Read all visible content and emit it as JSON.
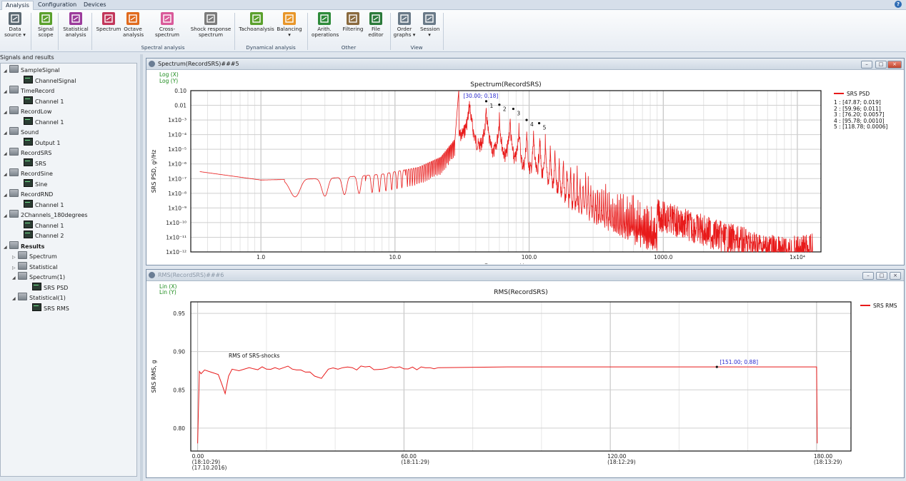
{
  "tabs": [
    "Analysis",
    "Configuration",
    "Devices"
  ],
  "ribbon": {
    "buttons": [
      {
        "label": "Data\nsource ▾",
        "icon": "data-source-icon",
        "color": "#5d6a73"
      },
      {
        "label": "Signal\nscope",
        "icon": "signal-scope-icon",
        "color": "#5aa02c"
      },
      {
        "label": "Statistical\nanalysis",
        "icon": "statistical-icon",
        "color": "#9b3b9b"
      },
      {
        "label": "Spectrum",
        "icon": "spectrum-icon",
        "color": "#c2365a"
      },
      {
        "label": "Octave\nanalysis",
        "icon": "octave-icon",
        "color": "#e06a1d"
      },
      {
        "label": "Cross-spectrum",
        "icon": "cross-spectrum-icon",
        "color": "#d95a9a"
      },
      {
        "label": "Shock response\nspectrum",
        "icon": "shock-icon",
        "color": "#7b7b7b"
      },
      {
        "label": "Tachoanalysis",
        "icon": "tacho-icon",
        "color": "#5aa02c"
      },
      {
        "label": "Balancing\n▾",
        "icon": "balancing-icon",
        "color": "#e8962a"
      },
      {
        "label": "Arith.\noperations",
        "icon": "arith-icon",
        "color": "#2e8b3a"
      },
      {
        "label": "Filtering",
        "icon": "filter-icon",
        "color": "#8a6a3e"
      },
      {
        "label": "File\neditor",
        "icon": "file-editor-icon",
        "color": "#2b7a3a"
      },
      {
        "label": "Order\ngraphs ▾",
        "icon": "order-graphs-icon",
        "color": "#6a7a88"
      },
      {
        "label": "Session\n▾",
        "icon": "session-icon",
        "color": "#6a7a88"
      }
    ],
    "groups": [
      "Spectral analysis",
      "Dynamical analysis",
      "Other",
      "View"
    ]
  },
  "left": {
    "header": "Signals and results",
    "tree": [
      {
        "label": "SampleSignal",
        "type": "folder",
        "depth": 0
      },
      {
        "label": "ChannelSignal",
        "type": "channel",
        "depth": 1
      },
      {
        "label": "TimeRecord",
        "type": "folder",
        "depth": 0
      },
      {
        "label": "Channel 1",
        "type": "channel",
        "depth": 1
      },
      {
        "label": "RecordLow",
        "type": "folder",
        "depth": 0
      },
      {
        "label": "Channel 1",
        "type": "channel",
        "depth": 1
      },
      {
        "label": "Sound",
        "type": "folder",
        "depth": 0
      },
      {
        "label": "Output 1",
        "type": "channel",
        "depth": 1
      },
      {
        "label": "RecordSRS",
        "type": "folder",
        "depth": 0
      },
      {
        "label": "SRS",
        "type": "channel",
        "depth": 1
      },
      {
        "label": "RecordSine",
        "type": "folder",
        "depth": 0
      },
      {
        "label": "Sine",
        "type": "channel",
        "depth": 1
      },
      {
        "label": "RecordRND",
        "type": "folder",
        "depth": 0
      },
      {
        "label": "Channel 1",
        "type": "channel",
        "depth": 1
      },
      {
        "label": "2Channels_180degrees",
        "type": "folder",
        "depth": 0
      },
      {
        "label": "Channel 1",
        "type": "channel",
        "depth": 1
      },
      {
        "label": "Channel 2",
        "type": "channel",
        "depth": 1
      },
      {
        "label": "Results",
        "type": "folder",
        "depth": 0,
        "bold": true
      },
      {
        "label": "Spectrum",
        "type": "folder",
        "depth": 1,
        "collapsed": true
      },
      {
        "label": "Statistical",
        "type": "folder",
        "depth": 1,
        "collapsed": true
      },
      {
        "label": "Spectrum(1)",
        "type": "folder",
        "depth": 1
      },
      {
        "label": "SRS PSD",
        "type": "channel",
        "depth": 2
      },
      {
        "label": "Statistical(1)",
        "type": "folder",
        "depth": 1
      },
      {
        "label": "SRS RMS",
        "type": "channel",
        "depth": 2
      }
    ]
  },
  "panel1": {
    "title": "Spectrum(RecordSRS)###5",
    "scale_x": "Log (X)",
    "scale_y": "Log (Y)",
    "legend": "SRS PSD",
    "peaks": [
      "1 : [47.87; 0.019]",
      "2 : [59.96; 0.011]",
      "3 : [76.20; 0.0057]",
      "4 : [95.78; 0.0010]",
      "5 : [118.78; 0.0006]"
    ]
  },
  "panel2": {
    "title": "RMS(RecordSRS)###6",
    "scale_x": "Lin (X)",
    "scale_y": "Lin (Y)",
    "legend": "SRS RMS"
  },
  "chart_data": [
    {
      "type": "line",
      "title": "Spectrum(RecordSRS)",
      "xlabel": "Frequency, Hz",
      "ylabel": "SRS PSD, g²/Hz",
      "xscale": "log",
      "yscale": "log",
      "xlim": [
        0.3,
        15000
      ],
      "ylim": [
        1e-12,
        0.1
      ],
      "xticks": [
        "1.0",
        "10.0",
        "100.0",
        "1000.0",
        "1x10⁴"
      ],
      "yticks": [
        "0.10",
        "0.01",
        "1x10⁻³",
        "1x10⁻⁴",
        "1x10⁻⁵",
        "1x10⁻⁶",
        "1x10⁻⁷",
        "1x10⁻⁸",
        "1x10⁻⁹",
        "1x10⁻¹⁰",
        "1x10⁻¹¹",
        "1x10⁻¹²"
      ],
      "cursor_label": "[30.00; 0.18]",
      "peak_labels": [
        "1",
        "2",
        "3",
        "4",
        "5"
      ],
      "peaks": [
        [
          47.87,
          0.019
        ],
        [
          59.96,
          0.011
        ],
        [
          76.2,
          0.0057
        ],
        [
          95.78,
          0.001
        ],
        [
          118.78,
          0.0006
        ]
      ],
      "series": [
        {
          "name": "SRS PSD",
          "color": "#e81a1a",
          "envelope": [
            [
              0.35,
              3e-07
            ],
            [
              1.0,
              8e-08
            ],
            [
              3.0,
              1e-07
            ],
            [
              8.0,
              2e-07
            ],
            [
              15.0,
              6e-07
            ],
            [
              22.0,
              3e-06
            ],
            [
              28.0,
              5e-05
            ],
            [
              30.0,
              0.18
            ],
            [
              48.0,
              0.019
            ],
            [
              60.0,
              0.011
            ],
            [
              76.0,
              0.0057
            ],
            [
              96.0,
              0.001
            ],
            [
              119.0,
              0.0006
            ],
            [
              200.0,
              5e-06
            ],
            [
              400.0,
              1e-07
            ],
            [
              700.0,
              1e-08
            ],
            [
              1000.0,
              3e-09
            ],
            [
              3000.0,
              1e-10
            ],
            [
              8000.0,
              1e-11
            ],
            [
              13000.0,
              2e-11
            ]
          ]
        }
      ]
    },
    {
      "type": "line",
      "title": "RMS(RecordSRS)",
      "xlabel": "",
      "ylabel": "SRS RMS, g",
      "xlim": [
        -2,
        190
      ],
      "ylim": [
        0.77,
        0.965
      ],
      "xticks": [
        "0.00\n(18:10:29)\n(17.10.2016)",
        "60.00\n(18:11:29)",
        "120.00\n(18:12:29)",
        "180.00\n(18:13:29)"
      ],
      "yticks": [
        "0.95",
        "0.90",
        "0.85",
        "0.80"
      ],
      "annotation": "RMS of SRS-shocks",
      "cursor_label": "[151.00; 0.88]",
      "series": [
        {
          "name": "SRS RMS",
          "color": "#e81a1a",
          "x": [
            0,
            0.5,
            1,
            2,
            4,
            6,
            7,
            8,
            9,
            10,
            12,
            15,
            20,
            25,
            30,
            34,
            36,
            38,
            45,
            55,
            70,
            90,
            120,
            151,
            170,
            180,
            180.2
          ],
          "y": [
            0.78,
            0.874,
            0.871,
            0.876,
            0.873,
            0.87,
            0.858,
            0.845,
            0.868,
            0.877,
            0.875,
            0.879,
            0.877,
            0.879,
            0.876,
            0.868,
            0.865,
            0.877,
            0.879,
            0.878,
            0.879,
            0.88,
            0.88,
            0.88,
            0.88,
            0.88,
            0.78
          ]
        }
      ]
    }
  ]
}
